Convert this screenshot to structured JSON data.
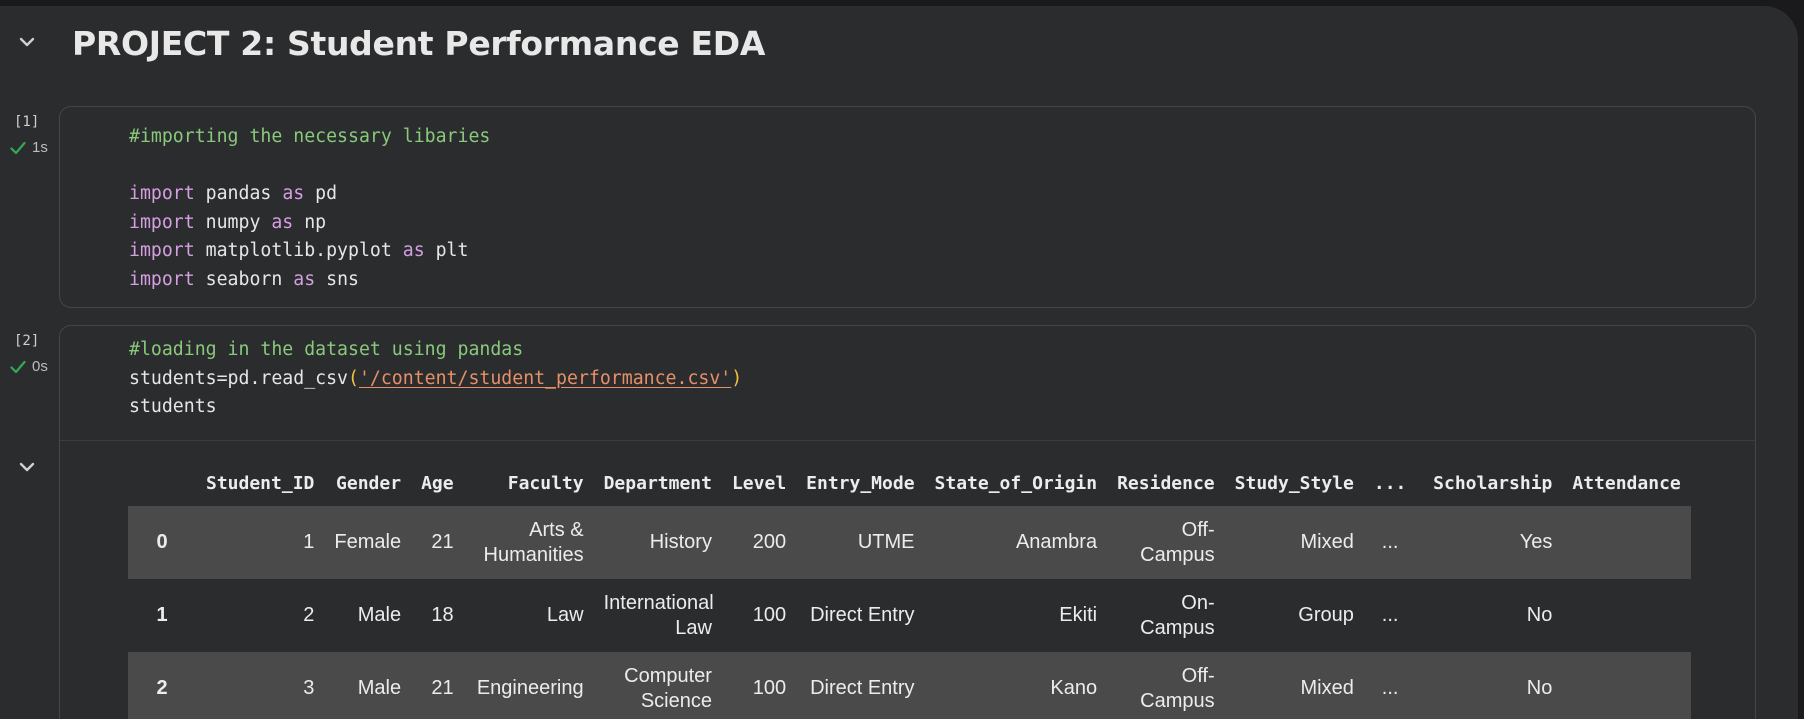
{
  "section": {
    "title": "PROJECT 2: Student Performance EDA"
  },
  "cells": [
    {
      "exec_count": "[1]",
      "duration": "1s",
      "lines": [
        [
          {
            "t": "#importing the necessary libaries",
            "c": "cm"
          }
        ],
        [],
        [
          {
            "t": "import",
            "c": "kw"
          },
          {
            "t": " pandas ",
            "c": ""
          },
          {
            "t": "as",
            "c": "kw"
          },
          {
            "t": " pd",
            "c": ""
          }
        ],
        [
          {
            "t": "import",
            "c": "kw"
          },
          {
            "t": " numpy ",
            "c": ""
          },
          {
            "t": "as",
            "c": "kw"
          },
          {
            "t": " np",
            "c": ""
          }
        ],
        [
          {
            "t": "import",
            "c": "kw"
          },
          {
            "t": " matplotlib.pyplot ",
            "c": ""
          },
          {
            "t": "as",
            "c": "kw"
          },
          {
            "t": " plt",
            "c": ""
          }
        ],
        [
          {
            "t": "import",
            "c": "kw"
          },
          {
            "t": " seaborn ",
            "c": ""
          },
          {
            "t": "as",
            "c": "kw"
          },
          {
            "t": " sns",
            "c": ""
          }
        ]
      ]
    },
    {
      "exec_count": "[2]",
      "duration": "0s",
      "lines": [
        [
          {
            "t": "#loading in the dataset using pandas",
            "c": "cm"
          }
        ],
        [
          {
            "t": "students=pd.read_csv",
            "c": ""
          },
          {
            "t": "(",
            "c": "pn"
          },
          {
            "t": "'/content/student_performance.csv'",
            "c": "st"
          },
          {
            "t": ")",
            "c": "pn"
          }
        ],
        [
          {
            "t": "students",
            "c": ""
          }
        ]
      ]
    }
  ],
  "dataframe": {
    "columns": [
      "",
      "Student_ID",
      "Gender",
      "Age",
      "Faculty",
      "Department",
      "Level",
      "Entry_Mode",
      "State_of_Origin",
      "Residence",
      "Study_Style",
      "...",
      "Scholarship",
      "Attendance"
    ],
    "rows": [
      [
        "0",
        "1",
        "Female",
        "21",
        "Arts & Humanities",
        "History",
        "200",
        "UTME",
        "Anambra",
        "Off-Campus",
        "Mixed",
        "...",
        "Yes",
        ""
      ],
      [
        "1",
        "2",
        "Male",
        "18",
        "Law",
        "International Law",
        "100",
        "Direct Entry",
        "Ekiti",
        "On-Campus",
        "Group",
        "...",
        "No",
        ""
      ],
      [
        "2",
        "3",
        "Male",
        "21",
        "Engineering",
        "Computer Science",
        "100",
        "Direct Entry",
        "Kano",
        "Off-Campus",
        "Mixed",
        "...",
        "No",
        ""
      ]
    ]
  },
  "icons": {
    "collapse": "chevron-down-icon",
    "success": "checkmark-icon"
  },
  "colors": {
    "background": "#2b2c2e",
    "comment": "#89c97c",
    "keyword": "#d69ee3",
    "string": "#e79068",
    "paren": "#f0c33c",
    "success": "#34a853"
  }
}
